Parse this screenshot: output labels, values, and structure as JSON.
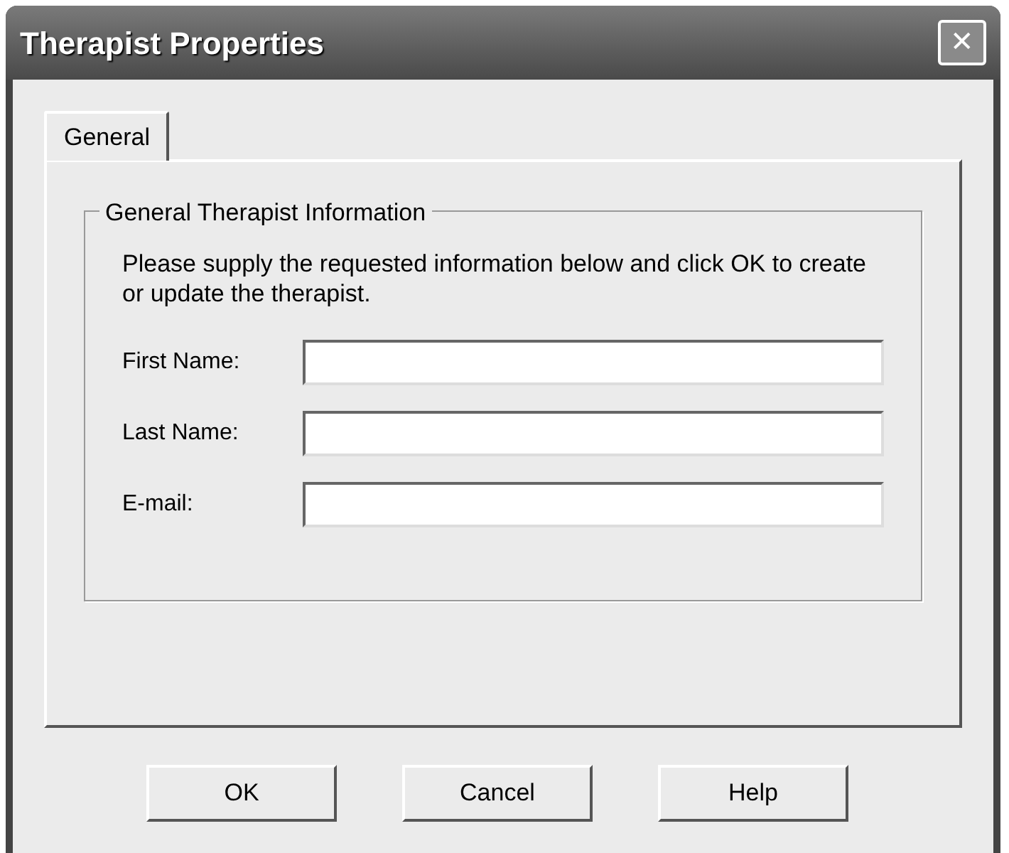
{
  "window": {
    "title": "Therapist Properties",
    "close": "✕"
  },
  "tabs": [
    {
      "label": "General",
      "selected": true
    }
  ],
  "group": {
    "title": "General Therapist Information",
    "instructions": "Please supply the requested information below and click OK to create or update the therapist.",
    "fields": [
      {
        "label": "First Name:"
      },
      {
        "label": "Last Name:"
      },
      {
        "label": "E-mail:"
      }
    ]
  },
  "buttons": [
    "OK",
    "Cancel",
    "Help"
  ]
}
